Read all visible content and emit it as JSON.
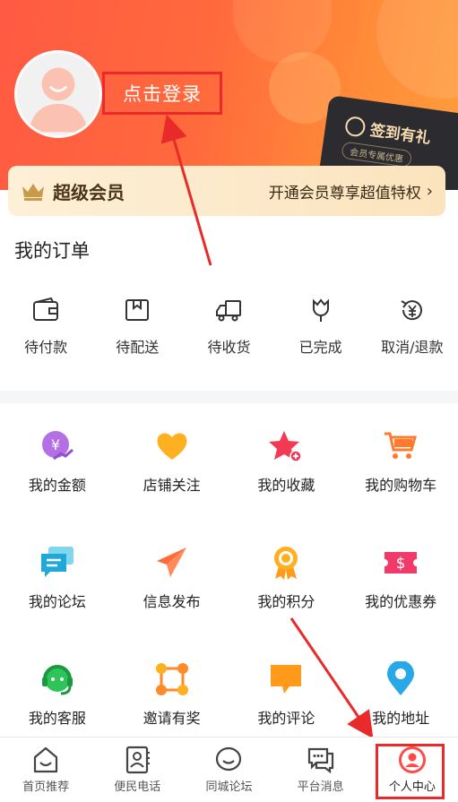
{
  "header": {
    "login_label": "点击登录",
    "sign_card_title": "签到有礼",
    "sign_card_sub": "会员专属优惠"
  },
  "vip": {
    "title": "超级会员",
    "cta": "开通会员尊享超值特权",
    "chevron": "›"
  },
  "orders": {
    "title": "我的订单",
    "items": [
      {
        "label": "待付款",
        "icon": "wallet-icon"
      },
      {
        "label": "待配送",
        "icon": "package-icon"
      },
      {
        "label": "待收货",
        "icon": "truck-icon"
      },
      {
        "label": "已完成",
        "icon": "tulip-icon"
      },
      {
        "label": "取消/退款",
        "icon": "refund-icon"
      }
    ]
  },
  "grid": {
    "items": [
      {
        "label": "我的金额",
        "icon": "money-icon"
      },
      {
        "label": "店铺关注",
        "icon": "heart-icon"
      },
      {
        "label": "我的收藏",
        "icon": "star-icon"
      },
      {
        "label": "我的购物车",
        "icon": "cart-icon"
      },
      {
        "label": "我的论坛",
        "icon": "forum-icon"
      },
      {
        "label": "信息发布",
        "icon": "send-icon"
      },
      {
        "label": "我的积分",
        "icon": "medal-icon"
      },
      {
        "label": "我的优惠券",
        "icon": "coupon-icon"
      },
      {
        "label": "我的客服",
        "icon": "headset-icon"
      },
      {
        "label": "邀请有奖",
        "icon": "invite-icon"
      },
      {
        "label": "我的评论",
        "icon": "comment-icon"
      },
      {
        "label": "我的地址",
        "icon": "location-icon"
      }
    ]
  },
  "tabbar": {
    "items": [
      {
        "label": "首页推荐",
        "icon": "home-icon"
      },
      {
        "label": "便民电话",
        "icon": "contacts-icon"
      },
      {
        "label": "同城论坛",
        "icon": "smile-icon"
      },
      {
        "label": "平台消息",
        "icon": "message-icon"
      },
      {
        "label": "个人中心",
        "icon": "user-icon",
        "active": true
      }
    ]
  },
  "colors": {
    "header_start": "#ff5a43",
    "header_end": "#ff9d3c",
    "annotation_red": "#e82a2a",
    "vip_bg": "#fbe3bd"
  }
}
